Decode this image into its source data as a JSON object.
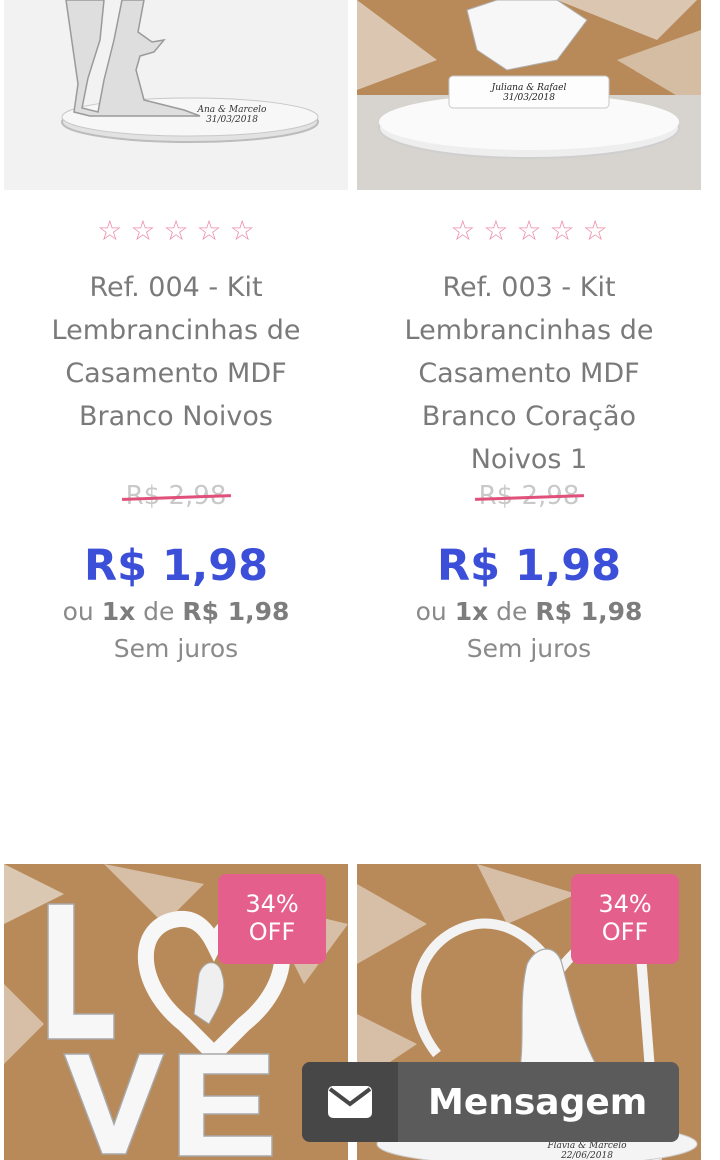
{
  "products": [
    {
      "title": "Ref. 004 - Kit\nLembrancinhas de\nCasamento MDF\nBranco Noivos",
      "old_price": "R$ 2,98",
      "price": "R$ 1,98",
      "inst_prefix": "ou",
      "inst_count": "1x",
      "inst_mid": "de",
      "inst_value": "R$ 1,98",
      "no_interest": "Sem juros",
      "plaque_text": "Ana & Marcelo\n31/03/2018"
    },
    {
      "title": "Ref. 003 - Kit\nLembrancinhas de\nCasamento MDF\nBranco Coração\nNoivos 1",
      "old_price": "R$ 2,98",
      "price": "R$ 1,98",
      "inst_prefix": "ou",
      "inst_count": "1x",
      "inst_mid": "de",
      "inst_value": "R$ 1,98",
      "no_interest": "Sem juros",
      "plaque_text": "Juliana & Rafael\n31/03/2018"
    },
    {
      "badge_pct": "34%",
      "badge_off": "OFF"
    },
    {
      "badge_pct": "34%",
      "badge_off": "OFF",
      "plaque_text": "Flávia & Marcelo\n22/06/2018"
    }
  ],
  "star_symbol": "☆",
  "message_button": {
    "label": "Mensagem",
    "icon": "envelope-icon"
  },
  "colors": {
    "price": "#3c4fd8",
    "badge": "#e55f8d",
    "star": "#ee8ea8",
    "strike": "#e0507a"
  }
}
